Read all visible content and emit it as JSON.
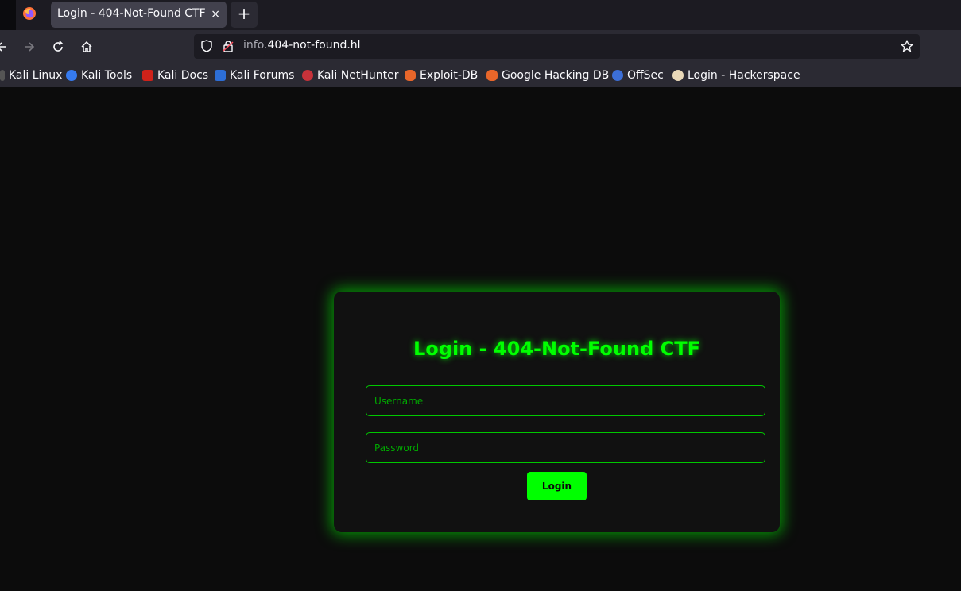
{
  "browser": {
    "tab": {
      "title": "Login - 404-Not-Found CTF",
      "close_glyph": "×"
    },
    "new_tab_glyph": "+",
    "url": {
      "subdomain": "info.",
      "domain": "404-not-found.hl"
    },
    "bookmarks": [
      {
        "label": "Kali Linux",
        "icon": "kali-linux-icon"
      },
      {
        "label": "Kali Tools",
        "icon": "kali-tools-icon"
      },
      {
        "label": "Kali Docs",
        "icon": "kali-docs-icon"
      },
      {
        "label": "Kali Forums",
        "icon": "kali-forums-icon"
      },
      {
        "label": "Kali NetHunter",
        "icon": "kali-nethunter-icon"
      },
      {
        "label": "Exploit-DB",
        "icon": "exploit-db-icon"
      },
      {
        "label": "Google Hacking DB",
        "icon": "google-hacking-db-icon"
      },
      {
        "label": "OffSec",
        "icon": "offsec-icon"
      },
      {
        "label": "Login - Hackerspace",
        "icon": "hackerspace-icon"
      }
    ]
  },
  "login": {
    "title": "Login - 404-Not-Found CTF",
    "username_placeholder": "Username",
    "password_placeholder": "Password",
    "button_label": "Login"
  },
  "colors": {
    "accent": "#00ff00",
    "page_bg": "#0c0c0c",
    "card_bg": "#111111",
    "browser_bg": "#2b2a33"
  }
}
